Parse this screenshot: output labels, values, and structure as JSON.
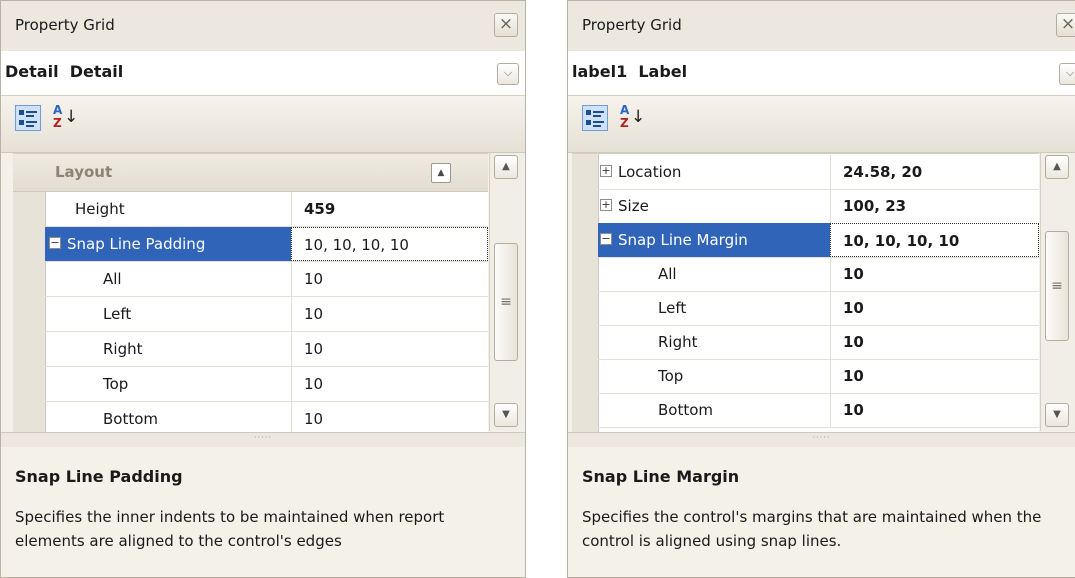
{
  "panels": [
    {
      "title": "Property Grid",
      "close_icon": "×",
      "object": "Detail  Detail",
      "category": "Layout",
      "rows": [
        {
          "name": "Height",
          "value": "459",
          "indent": 0
        },
        {
          "name": "Snap Line Padding",
          "value": "10, 10, 10, 10",
          "indent": 0,
          "expander": "−",
          "selected": true
        },
        {
          "name": "All",
          "value": "10",
          "indent": 1
        },
        {
          "name": "Left",
          "value": "10",
          "indent": 1
        },
        {
          "name": "Right",
          "value": "10",
          "indent": 1
        },
        {
          "name": "Top",
          "value": "10",
          "indent": 1
        },
        {
          "name": "Bottom",
          "value": "10",
          "indent": 1
        }
      ],
      "description": {
        "title": "Snap Line Padding",
        "text": "Specifies the inner indents to be maintained when report elements are aligned to the control's edges"
      }
    },
    {
      "title": "Property Grid",
      "close_icon": "×",
      "object": "label1  Label",
      "rows": [
        {
          "name": "Location",
          "value": "24.58, 20",
          "indent": 0,
          "expander": "+"
        },
        {
          "name": "Size",
          "value": "100, 23",
          "indent": 0,
          "expander": "+"
        },
        {
          "name": "Snap Line Margin",
          "value": "10, 10, 10, 10",
          "indent": 0,
          "expander": "−",
          "selected": true
        },
        {
          "name": "All",
          "value": "10",
          "indent": 1
        },
        {
          "name": "Left",
          "value": "10",
          "indent": 1
        },
        {
          "name": "Right",
          "value": "10",
          "indent": 1
        },
        {
          "name": "Top",
          "value": "10",
          "indent": 1
        },
        {
          "name": "Bottom",
          "value": "10",
          "indent": 1
        }
      ],
      "description": {
        "title": "Snap Line Margin",
        "text": "Specifies the control's margins that are maintained when the control is aligned using snap lines."
      }
    }
  ],
  "toolbar": {
    "alpha_a": "A",
    "alpha_z": "Z",
    "sort_arrow": "↓"
  },
  "scroll_thumb_glyph": "≡",
  "splitter_dots": "·····",
  "icons": {
    "categorized": "categorized-view-icon",
    "alphabetical": "alphabetical-sort-icon",
    "close": "close-icon",
    "dropdown": "chevron-down-icon"
  },
  "colors": {
    "selection": "#2f64b8",
    "panel": "#f4f1e9"
  }
}
